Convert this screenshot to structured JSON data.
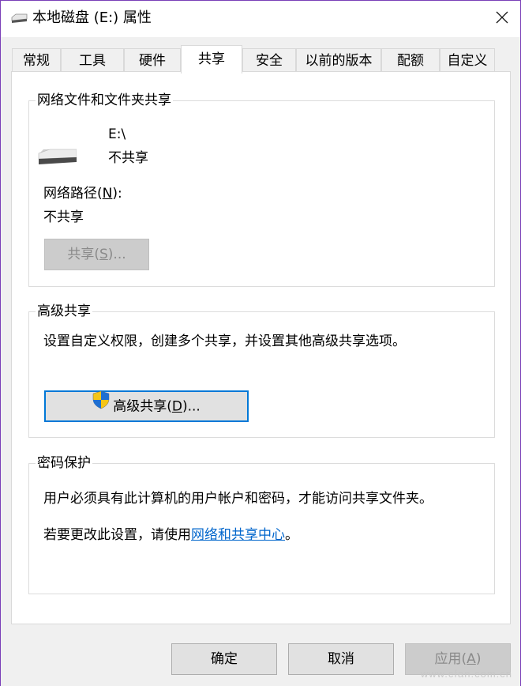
{
  "window": {
    "title": "本地磁盘 (E:) 属性",
    "accent_color": "#7a3fb8",
    "link_color": "#0066cc",
    "focus_color": "#0078d7"
  },
  "tabs": [
    {
      "label": "常规",
      "mnemonic_index": null
    },
    {
      "label": "工具"
    },
    {
      "label": "硬件"
    },
    {
      "label": "共享",
      "active": true
    },
    {
      "label": "安全"
    },
    {
      "label": "以前的版本"
    },
    {
      "label": "配额"
    },
    {
      "label": "自定义"
    }
  ],
  "network_sharing": {
    "legend": "网络文件和文件夹共享",
    "drive_path": "E:\\",
    "drive_status": "不共享",
    "network_path_label_pre": "网络路径(",
    "network_path_label_key": "N",
    "network_path_label_post": "):",
    "network_path_value": "不共享",
    "share_button_pre": "共享(",
    "share_button_key": "S",
    "share_button_post": ")..."
  },
  "advanced_sharing": {
    "legend": "高级共享",
    "description": "设置自定义权限，创建多个共享，并设置其他高级共享选项。",
    "button_pre": "高级共享(",
    "button_key": "D",
    "button_post": ")..."
  },
  "password_protection": {
    "legend": "密码保护",
    "description": "用户必须具有此计算机的用户帐户和密码，才能访问共享文件夹。",
    "change_text_pre": "若要更改此设置，请使用",
    "change_link": "网络和共享中心",
    "change_text_post": "。"
  },
  "footer": {
    "ok_label": "确定",
    "cancel_label": "取消",
    "apply_pre": "应用(",
    "apply_key": "A",
    "apply_post": ")"
  },
  "watermark": "www.cfan.com.cn"
}
